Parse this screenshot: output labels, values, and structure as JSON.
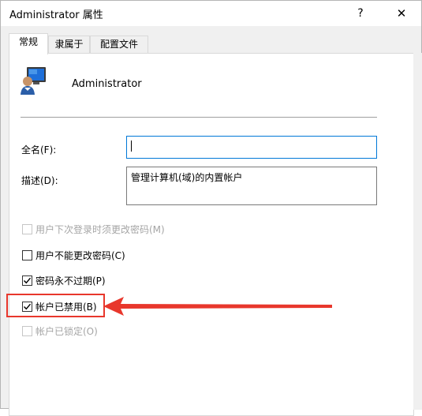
{
  "window": {
    "title": "Administrator 属性",
    "help_glyph": "?",
    "close_glyph": "✕"
  },
  "tabs": [
    {
      "label": "常规",
      "active": true
    },
    {
      "label": "隶属于",
      "active": false
    },
    {
      "label": "配置文件",
      "active": false
    }
  ],
  "general": {
    "user_name": "Administrator",
    "fullname_label": "全名(F):",
    "fullname_value": "",
    "description_label": "描述(D):",
    "description_value": "管理计算机(域)的内置帐户",
    "checkboxes": [
      {
        "label": "用户下次登录时须更改密码(M)",
        "checked": false,
        "enabled": false
      },
      {
        "label": "用户不能更改密码(C)",
        "checked": false,
        "enabled": true
      },
      {
        "label": "密码永不过期(P)",
        "checked": true,
        "enabled": true
      },
      {
        "label": "帐户已禁用(B)",
        "checked": true,
        "enabled": true
      },
      {
        "label": "帐户已锁定(O)",
        "checked": false,
        "enabled": false
      }
    ]
  },
  "colors": {
    "annotation_red": "#e8372c",
    "focus_blue": "#0078d7",
    "icon_screen_blue": "#1e6fd9"
  },
  "icons": {
    "user": "user-monitor-icon",
    "check": "checkmark-icon",
    "annotation_arrow": "arrow-left-icon"
  }
}
